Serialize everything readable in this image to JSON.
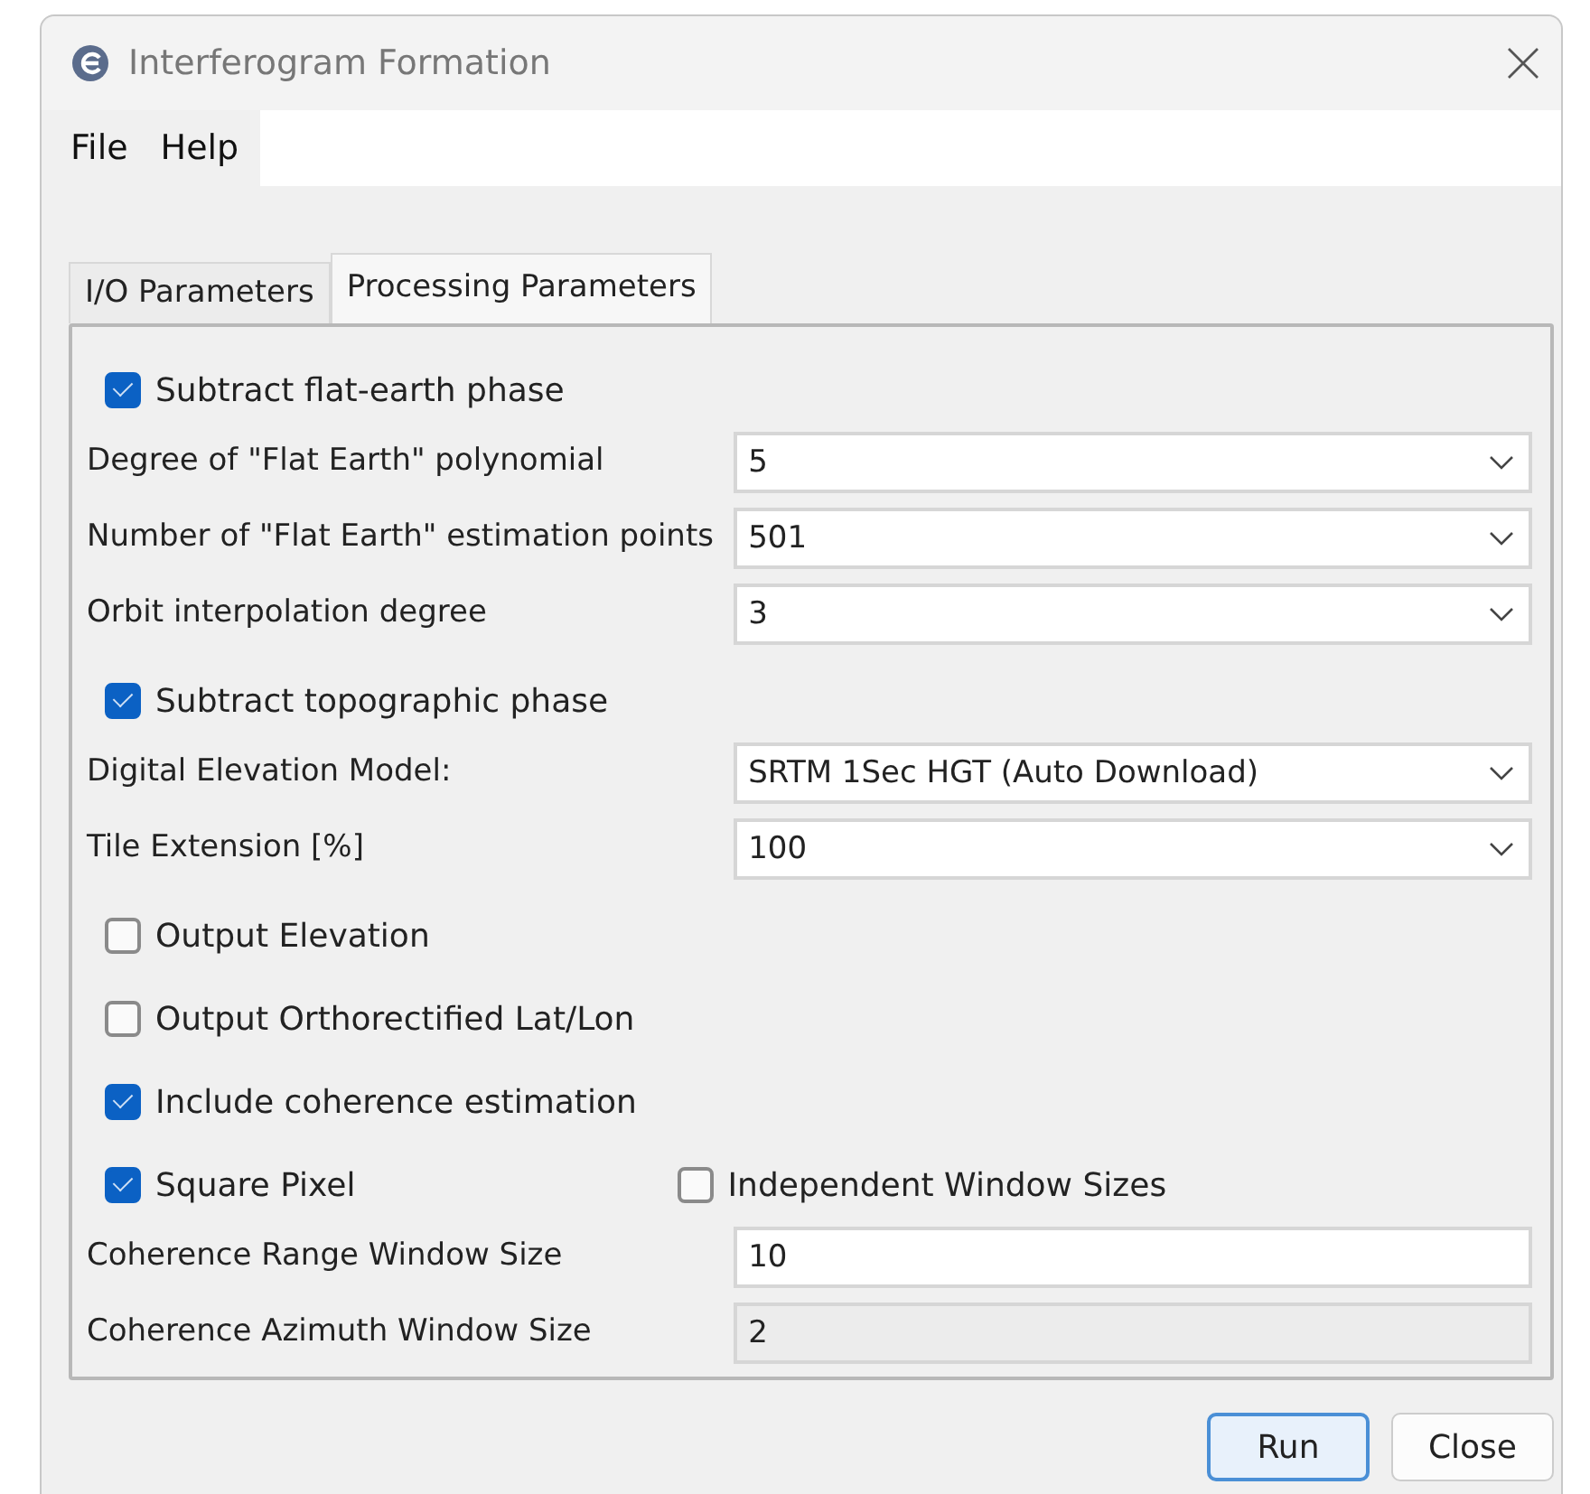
{
  "window": {
    "title": "Interferogram Formation"
  },
  "menu": [
    "File",
    "Help"
  ],
  "tabs": [
    {
      "label": "I/O Parameters",
      "selected": false
    },
    {
      "label": "Processing Parameters",
      "selected": true
    }
  ],
  "rows": [
    {
      "kind": "checkbox",
      "label": "Subtract flat-earth phase",
      "checked": true
    },
    {
      "kind": "combo",
      "label": "Degree of \"Flat Earth\" polynomial",
      "value": "5"
    },
    {
      "kind": "combo",
      "label": "Number of \"Flat Earth\" estimation points",
      "value": "501"
    },
    {
      "kind": "combo",
      "label": "Orbit interpolation degree",
      "value": "3"
    },
    {
      "kind": "checkbox",
      "label": "Subtract topographic phase",
      "checked": true
    },
    {
      "kind": "combo",
      "label": "Digital Elevation Model:",
      "value": "SRTM 1Sec HGT (Auto Download)"
    },
    {
      "kind": "combo",
      "label": "Tile Extension [%]",
      "value": "100"
    },
    {
      "kind": "checkbox",
      "label": "Output Elevation",
      "checked": false
    },
    {
      "kind": "checkbox",
      "label": "Output Orthorectified Lat/Lon",
      "checked": false
    },
    {
      "kind": "checkbox",
      "label": "Include coherence estimation",
      "checked": true
    },
    {
      "kind": "checkbox_pair",
      "items": [
        {
          "label": "Square Pixel",
          "checked": true
        },
        {
          "label": "Independent Window Sizes",
          "checked": false
        }
      ]
    },
    {
      "kind": "text",
      "label": "Coherence Range Window Size",
      "value": "10",
      "disabled": false
    },
    {
      "kind": "text",
      "label": "Coherence Azimuth Window Size",
      "value": "2",
      "disabled": true
    }
  ],
  "buttons": [
    {
      "label": "Run",
      "default": true
    },
    {
      "label": "Close",
      "default": false
    }
  ]
}
